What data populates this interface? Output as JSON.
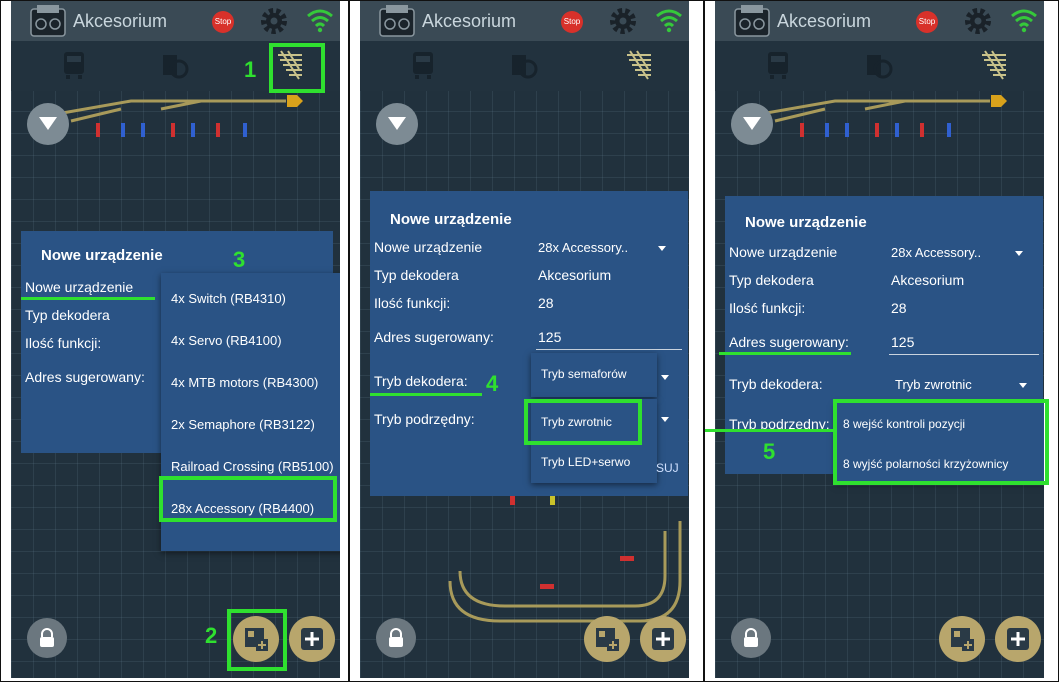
{
  "app": {
    "title": "Akcesorium",
    "stop_label": "Stop"
  },
  "dialog": {
    "title": "Nowe urządzenie",
    "labels": {
      "device": "Nowe urządzenie",
      "decoder_type": "Typ dekodera",
      "function_count": "Ilość funkcji:",
      "suggested_address": "Adres sugerowany:",
      "decoder_mode": "Tryb dekodera:",
      "sub_mode": "Tryb podrzędny:",
      "sub_mode_clipped": "Tryb podrzędny:"
    },
    "values": {
      "device": "28x Accessory..",
      "decoder_type": "Akcesorium",
      "function_count": "28",
      "suggested_address": "125"
    }
  },
  "panel1": {
    "device_options": [
      "4x Switch (RB4310)",
      "4x Servo (RB4100)",
      "4x MTB motors (RB4300)",
      "2x Semaphore (RB3122)",
      "Railroad Crossing (RB5100)",
      "28x Accessory (RB4400)"
    ]
  },
  "panel2": {
    "decoder_mode_value": "Tryb semaforów",
    "sub_mode_options": [
      "Tryb zwrotnic",
      "Tryb LED+serwo"
    ],
    "hidden_button_fragment": "SUJ"
  },
  "panel3": {
    "decoder_mode_value": "Tryb zwrotnic",
    "sub_mode_options": [
      "8 wejść kontroli pozycji",
      "8 wyjść polarności krzyżownicy"
    ]
  },
  "steps": [
    "1",
    "2",
    "3",
    "4",
    "5"
  ],
  "icons": [
    "app-logo-icon",
    "stop-icon",
    "gear-icon",
    "wifi-icon",
    "locomotive-icon",
    "accessory-icon",
    "turnout-icon",
    "chevron-down-icon",
    "lock-icon",
    "add-device-icon",
    "plus-icon"
  ],
  "colors": {
    "background": "#21313d",
    "dialog": "#2a5385",
    "highlight": "#2fe02f",
    "fab": "#b8a66c",
    "stop": "#d8312a",
    "wifi": "#35c93a"
  }
}
